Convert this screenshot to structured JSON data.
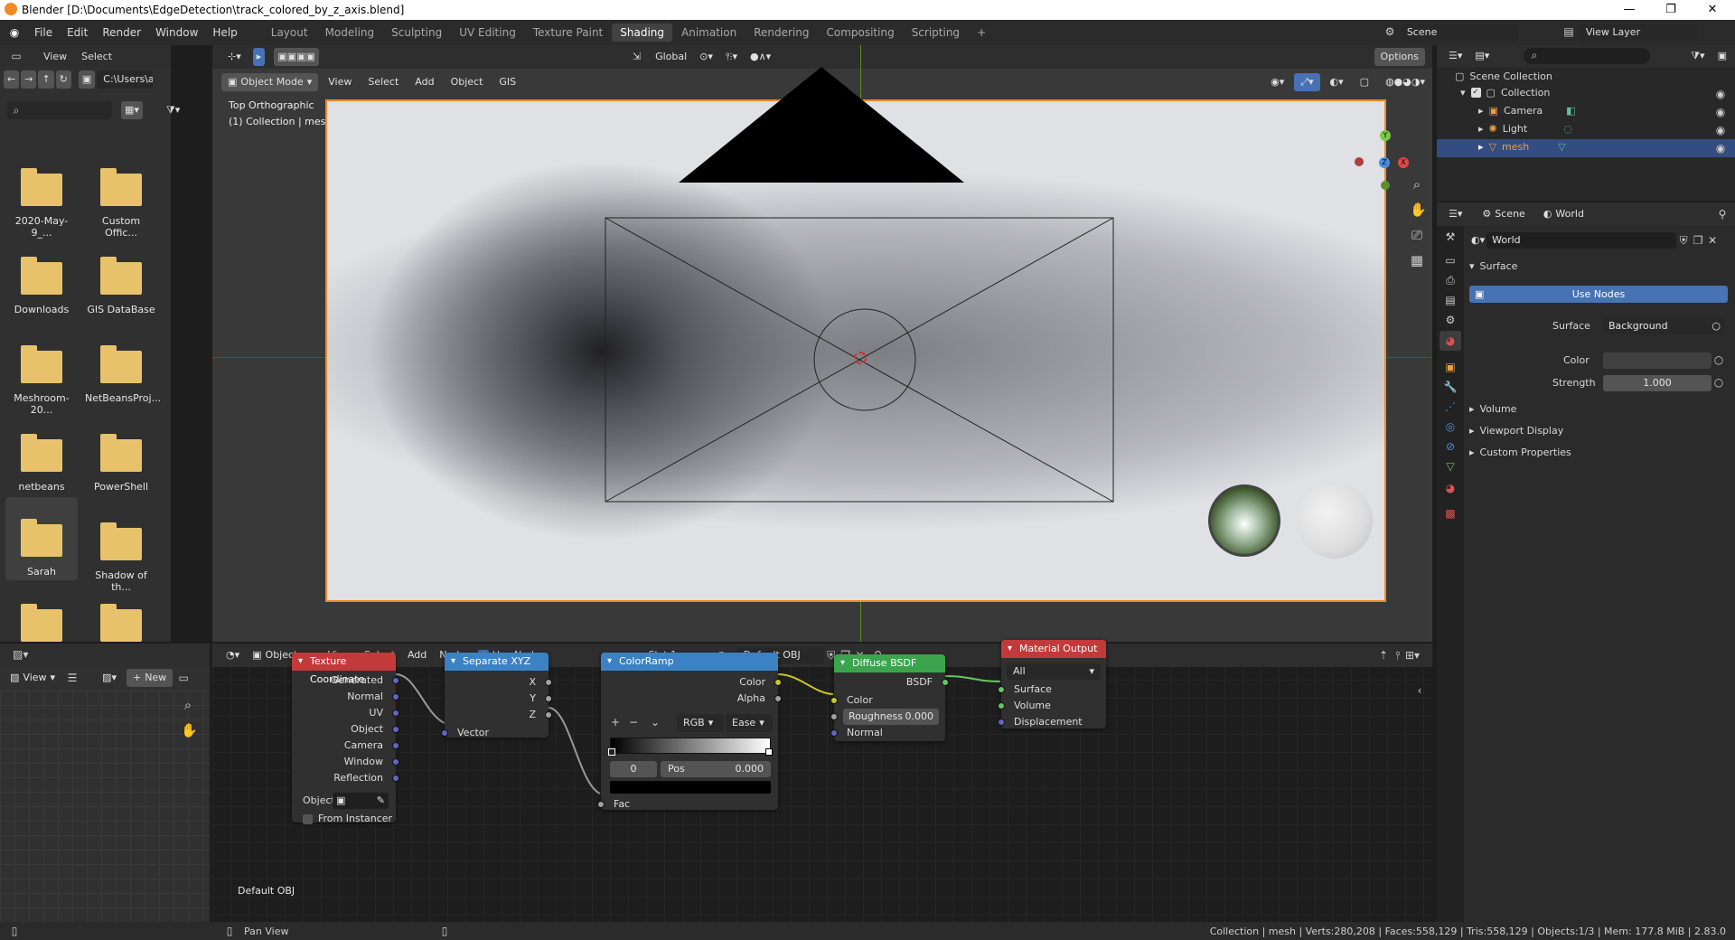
{
  "window": {
    "title": "Blender [D:\\Documents\\EdgeDetection\\track_colored_by_z_axis.blend]"
  },
  "menu": [
    "File",
    "Edit",
    "Render",
    "Window",
    "Help"
  ],
  "workspaces": [
    "Layout",
    "Modeling",
    "Sculpting",
    "UV Editing",
    "Texture Paint",
    "Shading",
    "Animation",
    "Rendering",
    "Compositing",
    "Scripting"
  ],
  "active_workspace": "Shading",
  "scene": {
    "label": "Scene",
    "view_layer": "View Layer"
  },
  "filebrowser": {
    "menu_view": "View",
    "menu_select": "Select",
    "path": "C:\\Users\\a...",
    "folders": [
      "2020-May-9_...",
      "Custom Offic...",
      "Downloads",
      "GIS DataBase",
      "Meshroom-20...",
      "NetBeansProj...",
      "netbeans",
      "PowerShell",
      "Sarah",
      "Shadow of th...",
      "",
      ""
    ]
  },
  "viewport": {
    "mode": "Object Mode",
    "menus": [
      "View",
      "Select",
      "Add",
      "Object",
      "GIS"
    ],
    "transform": "Global",
    "options": "Options",
    "overlay_line1": "Top Orthographic",
    "overlay_line2": "(1) Collection | mesh",
    "gizmo_x": "X",
    "gizmo_y": "Y",
    "gizmo_z": "Z"
  },
  "node_editor": {
    "type": "Object",
    "menus": [
      "View",
      "Select",
      "Add",
      "Node"
    ],
    "use_nodes": "Use Nodes",
    "slot": "Slot 1",
    "material": "Default OBJ",
    "footer_material": "Default OBJ",
    "nodes": {
      "texcoord": {
        "title": "Texture Coordinate",
        "outputs": [
          "Generated",
          "Normal",
          "UV",
          "Object",
          "Camera",
          "Window",
          "Reflection"
        ],
        "object_label": "Object:",
        "from_instancer": "From Instancer"
      },
      "sepxyz": {
        "title": "Separate XYZ",
        "outputs": [
          "X",
          "Y",
          "Z"
        ],
        "input": "Vector"
      },
      "colorramp": {
        "title": "ColorRamp",
        "out_color": "Color",
        "out_alpha": "Alpha",
        "mode": "RGB",
        "interp": "Ease",
        "index": "0",
        "pos_label": "Pos",
        "pos_value": "0.000",
        "input": "Fac"
      },
      "diffuse": {
        "title": "Diffuse BSDF",
        "output": "BSDF",
        "in_color": "Color",
        "roughness_label": "Roughness",
        "roughness_value": "0.000",
        "in_normal": "Normal"
      },
      "matout": {
        "title": "Material Output",
        "target": "All",
        "inputs": [
          "Surface",
          "Volume",
          "Displacement"
        ]
      }
    }
  },
  "image_editor": {
    "view": "View",
    "new": "New"
  },
  "outliner": {
    "root": "Scene Collection",
    "items": [
      "Collection",
      "Camera",
      "Light",
      "mesh"
    ]
  },
  "properties": {
    "tab_scene": "Scene",
    "tab_world": "World",
    "world_name": "World",
    "surface_panel": "Surface",
    "use_nodes": "Use Nodes",
    "surface_label": "Surface",
    "surface_value": "Background",
    "color_label": "Color",
    "strength_label": "Strength",
    "strength_value": "1.000",
    "collapsed": [
      "Volume",
      "Viewport Display",
      "Custom Properties"
    ]
  },
  "status": {
    "left": "Pan View",
    "right": "Collection | mesh | Verts:280,208 | Faces:558,129 | Tris:558,129 | Objects:1/3 | Mem: 177.8 MiB | 2.83.0"
  },
  "colors": {
    "accent": "#4772b3",
    "selection_orange": "#f08a24",
    "header": "#2e2e2e",
    "texcoord_header": "#c23a3a",
    "converter_header": "#3b82c4",
    "shader_header": "#3ca44c",
    "output_header": "#c23a3a"
  }
}
